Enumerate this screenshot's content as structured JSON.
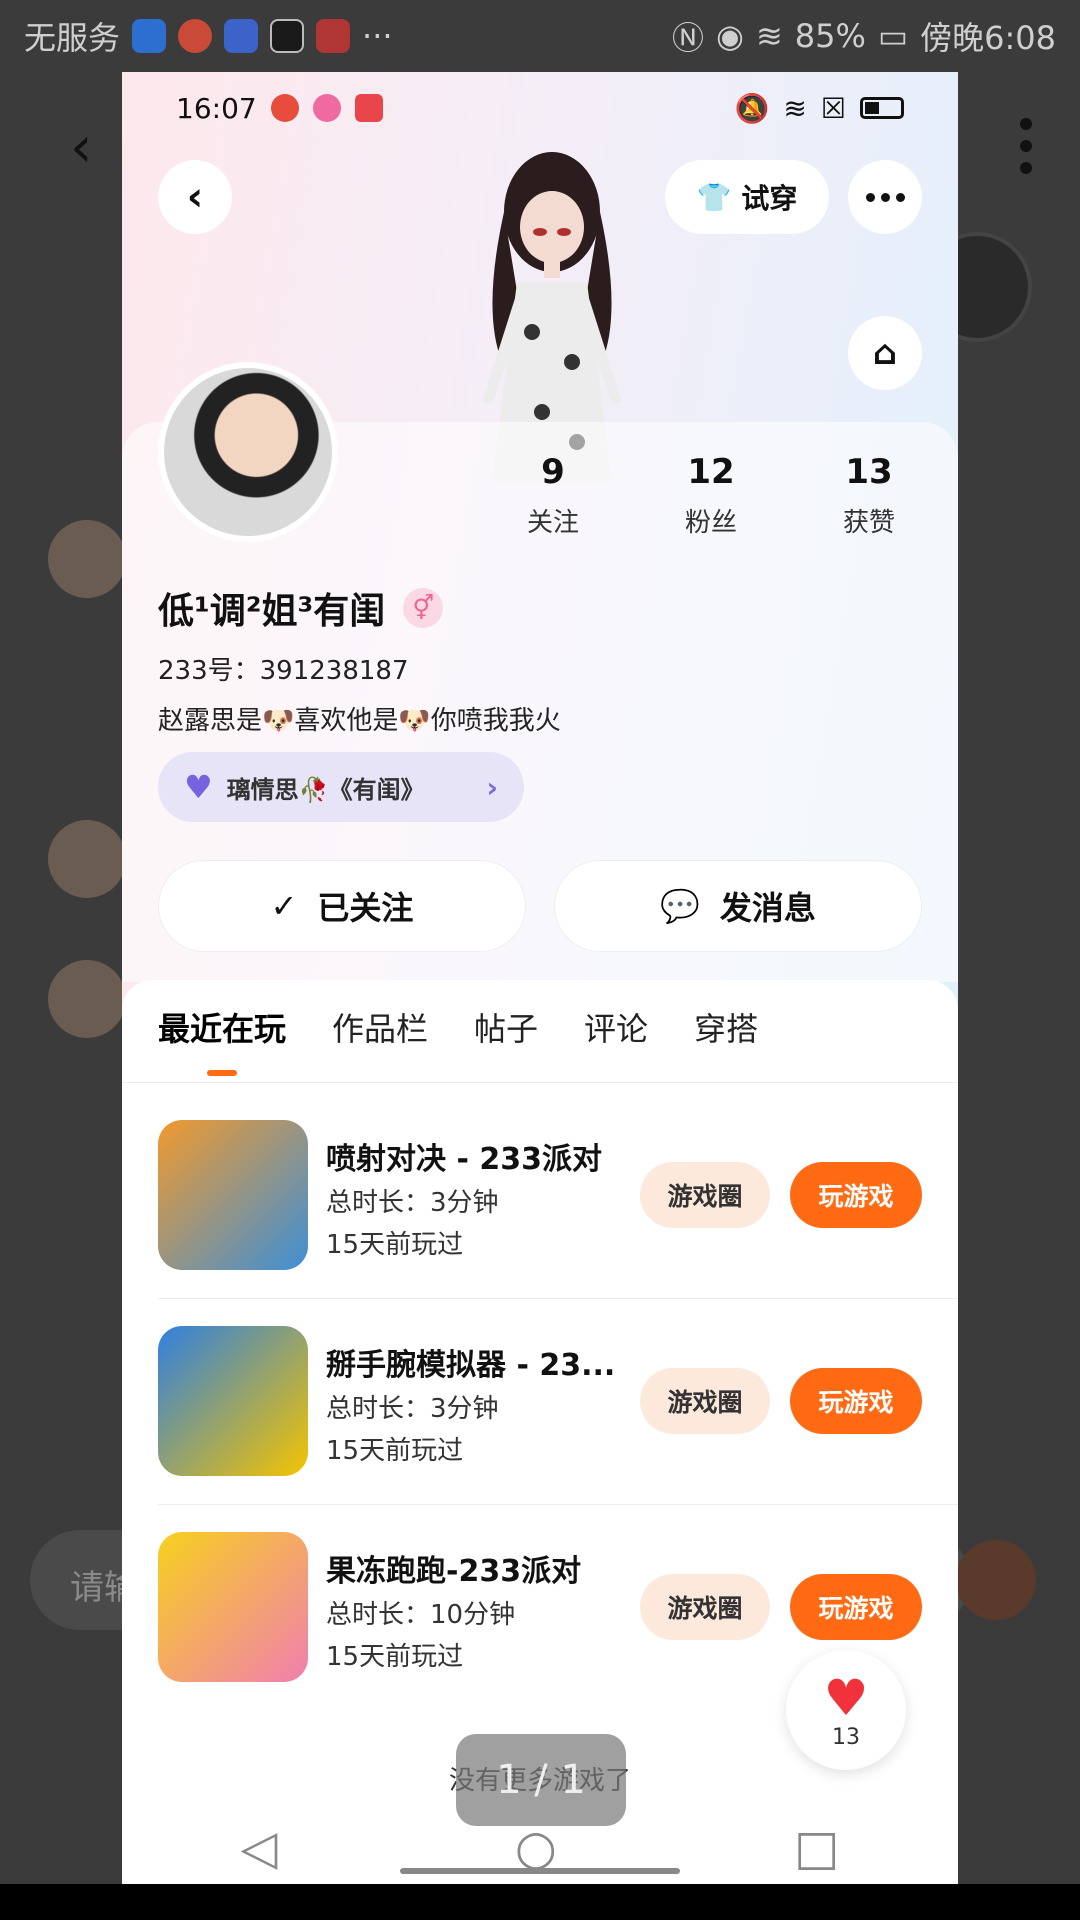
{
  "outer": {
    "status": {
      "carrier": "无服务",
      "battery": "85%",
      "time": "傍晚6:08"
    },
    "input_placeholder": "请输"
  },
  "phone": {
    "status": {
      "time": "16:07"
    },
    "try_on_label": "试穿",
    "profile": {
      "stats": [
        {
          "value": "9",
          "label": "关注"
        },
        {
          "value": "12",
          "label": "粉丝"
        },
        {
          "value": "13",
          "label": "获赞"
        }
      ],
      "name": "低¹调²姐³有闺",
      "gender_symbol": "⚥",
      "uid": "233号：391238187",
      "bio": "赵露思是🐶喜欢他是🐶你喷我我火",
      "relation_pill": "璃情思🥀《有闺》",
      "follow_label": "已关注",
      "message_label": "发消息"
    },
    "tabs": [
      "最近在玩",
      "作品栏",
      "帖子",
      "评论",
      "穿搭"
    ],
    "games": [
      {
        "title": "喷射对决 - 233派对",
        "duration": "总时长：3分钟",
        "last_played": "15天前玩过",
        "circle_label": "游戏圈",
        "play_label": "玩游戏"
      },
      {
        "title": "掰手腕模拟器 - 23...",
        "duration": "总时长：3分钟",
        "last_played": "15天前玩过",
        "circle_label": "游戏圈",
        "play_label": "玩游戏"
      },
      {
        "title": "果冻跑跑-233派对",
        "duration": "总时长：10分钟",
        "last_played": "15天前玩过",
        "circle_label": "游戏圈",
        "play_label": "玩游戏"
      }
    ],
    "likes_count": "13",
    "no_more": "没有更多游戏了",
    "pager": "1 / 1"
  },
  "colors": {
    "accent": "#ff6a13",
    "pill_bg": "#e6e4f6",
    "like": "#f2323a"
  }
}
